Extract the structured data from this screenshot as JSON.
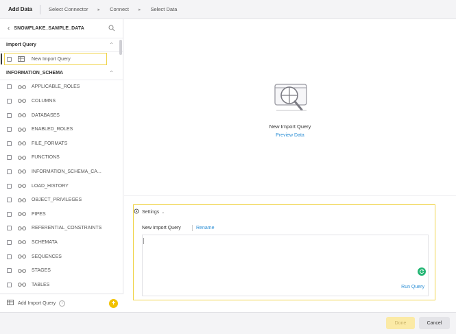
{
  "header": {
    "title": "Add Data",
    "steps": [
      "Select Connector",
      "Connect",
      "Select Data"
    ]
  },
  "sidebar": {
    "database": "SNOWFLAKE_SAMPLE_DATA",
    "import_section": "Import Query",
    "import_item": "New Import Query",
    "schema_section": "INFORMATION_SCHEMA",
    "tables": [
      "APPLICABLE_ROLES",
      "COLUMNS",
      "DATABASES",
      "ENABLED_ROLES",
      "FILE_FORMATS",
      "FUNCTIONS",
      "INFORMATION_SCHEMA_CA...",
      "LOAD_HISTORY",
      "OBJECT_PRIVILEGES",
      "PIPES",
      "REFERENTIAL_CONSTRAINTS",
      "SCHEMATA",
      "SEQUENCES",
      "STAGES",
      "TABLES"
    ],
    "footer_label": "Add Import Query"
  },
  "preview": {
    "title": "New Import Query",
    "link": "Preview Data"
  },
  "editor": {
    "settings_label": "Settings",
    "query_name": "New Import Query",
    "rename_label": "Rename",
    "run_label": "Run Query",
    "query_text": ""
  },
  "footer": {
    "done_label": "Done",
    "cancel_label": "Cancel"
  },
  "colors": {
    "highlight": "#f0d44a",
    "link": "#2d8fd5",
    "add_button": "#f2c200",
    "refresh": "#22b573"
  }
}
